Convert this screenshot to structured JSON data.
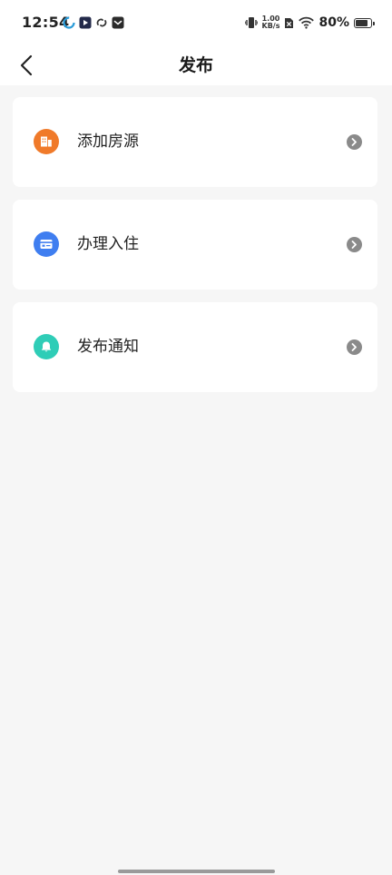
{
  "status_bar": {
    "time": "12:54",
    "net_speed_value": "1.00",
    "net_speed_unit": "KB/s",
    "battery_percent": "80%",
    "battery_level": 0.8
  },
  "header": {
    "title": "发布",
    "back_icon": "chevron-left-icon"
  },
  "menu": {
    "items": [
      {
        "label": "添加房源",
        "icon": "building-icon",
        "color": "#f07a2a"
      },
      {
        "label": "办理入住",
        "icon": "card-icon",
        "color": "#3f7ef0"
      },
      {
        "label": "发布通知",
        "icon": "bell-icon",
        "color": "#2fcdb7"
      }
    ]
  },
  "colors": {
    "background": "#f6f6f6",
    "card": "#ffffff",
    "chevron": "#8a8a8a"
  }
}
